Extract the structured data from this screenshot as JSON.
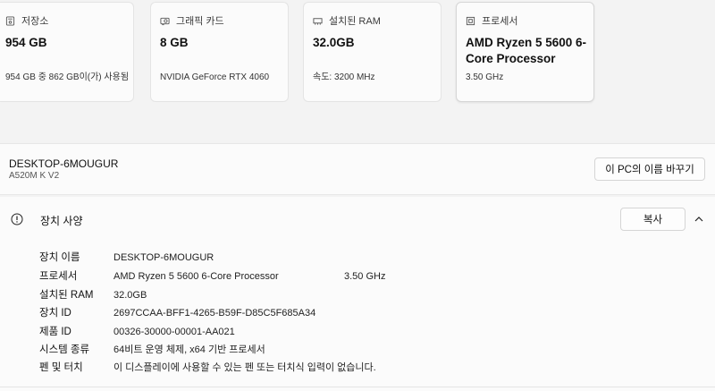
{
  "cards": [
    {
      "icon": "storage-icon",
      "title": "저장소",
      "value": "954 GB",
      "sub": "954 GB 중 862 GB이(가) 사용됨"
    },
    {
      "icon": "graphics-card-icon",
      "title": "그래픽 카드",
      "value": "8 GB",
      "sub": "NVIDIA GeForce RTX 4060"
    },
    {
      "icon": "memory-icon",
      "title": "설치된 RAM",
      "value": "32.0GB",
      "sub": "속도: 3200 MHz"
    },
    {
      "icon": "processor-icon",
      "title": "프로세서",
      "value": "AMD Ryzen 5 5600 6-Core Processor",
      "sub": "3.50 GHz"
    }
  ],
  "device": {
    "name": "DESKTOP-6MOUGUR",
    "model": "A520M K V2",
    "rename_label": "이 PC의 이름 바꾸기"
  },
  "specs": {
    "title": "장치 사양",
    "copy_label": "복사",
    "rows": [
      {
        "label": "장치 이름",
        "value": "DESKTOP-6MOUGUR",
        "extra": ""
      },
      {
        "label": "프로세서",
        "value": "AMD Ryzen 5 5600 6-Core Processor",
        "extra": "3.50 GHz"
      },
      {
        "label": "설치된 RAM",
        "value": "32.0GB",
        "extra": ""
      },
      {
        "label": "장치 ID",
        "value": "2697CCAA-BFF1-4265-B59F-D85C5F685A34",
        "extra": ""
      },
      {
        "label": "제품 ID",
        "value": "00326-30000-00001-AA021",
        "extra": ""
      },
      {
        "label": "시스템 종류",
        "value": "64비트 운영 체제, x64 기반 프로세서",
        "extra": ""
      },
      {
        "label": "펜 및 터치",
        "value": "이 디스플레이에 사용할 수 있는 펜 또는 터치식 입력이 없습니다.",
        "extra": ""
      }
    ]
  }
}
